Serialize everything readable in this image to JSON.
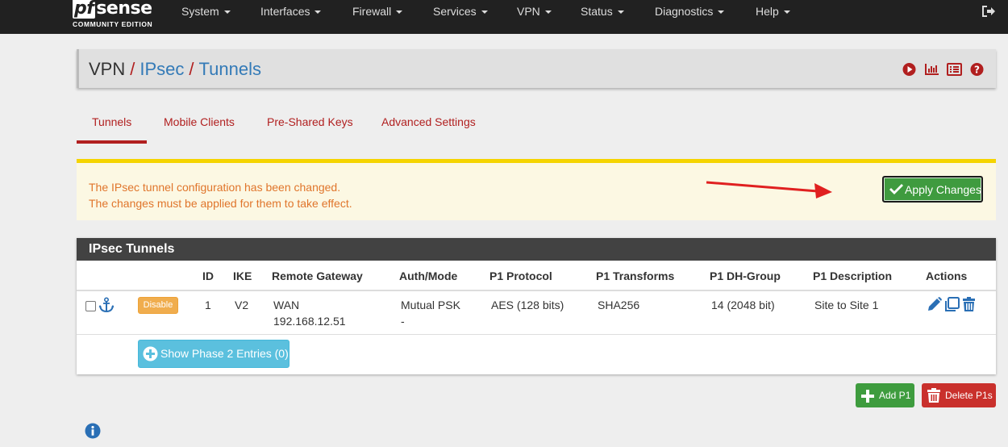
{
  "brand": {
    "logo_main": "sense",
    "logo_pf": "pf",
    "logo_sub": "COMMUNITY EDITION"
  },
  "nav": [
    {
      "label": "System"
    },
    {
      "label": "Interfaces"
    },
    {
      "label": "Firewall"
    },
    {
      "label": "Services"
    },
    {
      "label": "VPN"
    },
    {
      "label": "Status"
    },
    {
      "label": "Diagnostics"
    },
    {
      "label": "Help"
    }
  ],
  "breadcrumb": {
    "root": "VPN",
    "sep": "/",
    "level1": "IPsec",
    "level2": "Tunnels"
  },
  "breadcrumb_icons": [
    "play-circle-icon",
    "bar-chart-icon",
    "list-icon",
    "help-icon"
  ],
  "tabs": [
    {
      "label": "Tunnels",
      "active": true
    },
    {
      "label": "Mobile Clients"
    },
    {
      "label": "Pre-Shared Keys"
    },
    {
      "label": "Advanced Settings"
    }
  ],
  "alert": {
    "line1": "The IPsec tunnel configuration has been changed.",
    "line2": "The changes must be applied for them to take effect.",
    "apply_label": "Apply Changes"
  },
  "panel": {
    "title": "IPsec Tunnels",
    "headers": {
      "id": "ID",
      "ike": "IKE",
      "gateway": "Remote Gateway",
      "auth": "Auth/Mode",
      "p1proto": "P1 Protocol",
      "p1trans": "P1 Transforms",
      "p1dh": "P1 DH-Group",
      "p1desc": "P1 Description",
      "actions": "Actions"
    },
    "row": {
      "disable_label": "Disable",
      "id": "1",
      "ike": "V2",
      "gateway_iface": "WAN",
      "gateway_ip": "192.168.12.51",
      "auth_mode": "Mutual PSK",
      "auth_dash": "-",
      "p1proto": "AES (128 bits)",
      "p1trans": "SHA256",
      "p1dh": "14 (2048 bit)",
      "p1desc": "Site to Site 1"
    },
    "show_phase2_label": "Show Phase 2 Entries (0)"
  },
  "buttons": {
    "add_p1": "Add P1",
    "delete_p1s": "Delete P1s"
  },
  "colors": {
    "accent_red": "#b11f1f",
    "link_blue": "#337ab7",
    "success_green": "#3e9c3e",
    "warning_orange": "#f0ad4e",
    "info_cyan": "#5bc0de"
  }
}
